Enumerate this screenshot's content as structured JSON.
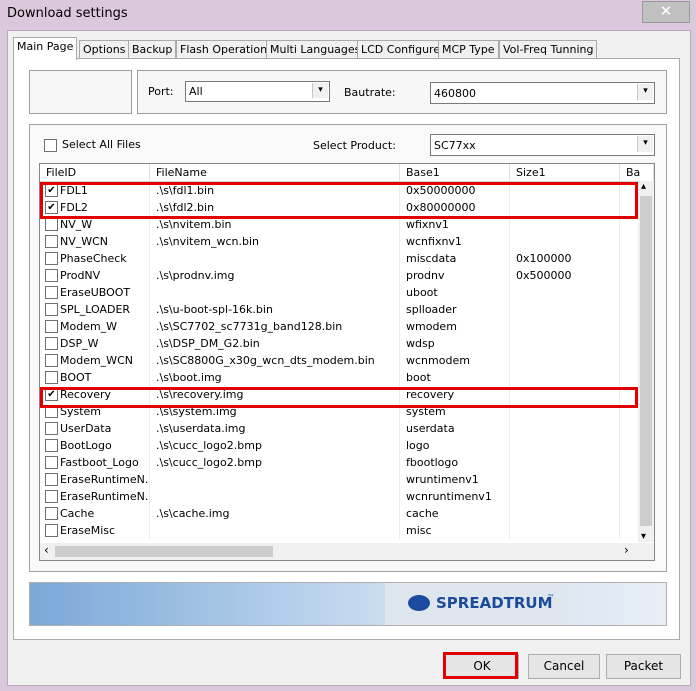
{
  "window": {
    "title": "Download settings",
    "close_glyph": "✕"
  },
  "tabs": [
    "Main Page",
    "Options",
    "Backup",
    "Flash Operations",
    "Multi Languages",
    "LCD Configure",
    "MCP Type",
    "Vol-Freq Tunning"
  ],
  "port": {
    "label": "Port:",
    "value": "All"
  },
  "baudrate": {
    "label": "Bautrate:",
    "value": "460800"
  },
  "select_all": {
    "label": "Select All Files",
    "checked": false
  },
  "product": {
    "label": "Select Product:",
    "value": "SC77xx"
  },
  "columns": [
    "FileID",
    "FileName",
    "Base1",
    "Size1",
    "Ba"
  ],
  "rows": [
    {
      "id": "FDL1",
      "file": ".\\s\\fdl1.bin",
      "base": "0x50000000",
      "size": "",
      "checked": true
    },
    {
      "id": "FDL2",
      "file": ".\\s\\fdl2.bin",
      "base": "0x80000000",
      "size": "",
      "checked": true
    },
    {
      "id": "NV_W",
      "file": ".\\s\\nvitem.bin",
      "base": "wfixnv1",
      "size": "",
      "checked": false
    },
    {
      "id": "NV_WCN",
      "file": ".\\s\\nvitem_wcn.bin",
      "base": "wcnfixnv1",
      "size": "",
      "checked": false
    },
    {
      "id": "PhaseCheck",
      "file": "",
      "base": "miscdata",
      "size": "0x100000",
      "checked": false
    },
    {
      "id": "ProdNV",
      "file": ".\\s\\prodnv.img",
      "base": "prodnv",
      "size": "0x500000",
      "checked": false
    },
    {
      "id": "EraseUBOOT",
      "file": "",
      "base": "uboot",
      "size": "",
      "checked": false
    },
    {
      "id": "SPL_LOADER",
      "file": ".\\s\\u-boot-spl-16k.bin",
      "base": "splloader",
      "size": "",
      "checked": false
    },
    {
      "id": "Modem_W",
      "file": ".\\s\\SC7702_sc7731g_band128.bin",
      "base": "wmodem",
      "size": "",
      "checked": false
    },
    {
      "id": "DSP_W",
      "file": ".\\s\\DSP_DM_G2.bin",
      "base": "wdsp",
      "size": "",
      "checked": false
    },
    {
      "id": "Modem_WCN",
      "file": ".\\s\\SC8800G_x30g_wcn_dts_modem.bin",
      "base": "wcnmodem",
      "size": "",
      "checked": false
    },
    {
      "id": "BOOT",
      "file": ".\\s\\boot.img",
      "base": "boot",
      "size": "",
      "checked": false
    },
    {
      "id": "Recovery",
      "file": ".\\s\\recovery.img",
      "base": "recovery",
      "size": "",
      "checked": true
    },
    {
      "id": "System",
      "file": ".\\s\\system.img",
      "base": "system",
      "size": "",
      "checked": false
    },
    {
      "id": "UserData",
      "file": ".\\s\\userdata.img",
      "base": "userdata",
      "size": "",
      "checked": false
    },
    {
      "id": "BootLogo",
      "file": ".\\s\\cucc_logo2.bmp",
      "base": "logo",
      "size": "",
      "checked": false
    },
    {
      "id": "Fastboot_Logo",
      "file": ".\\s\\cucc_logo2.bmp",
      "base": "fbootlogo",
      "size": "",
      "checked": false
    },
    {
      "id": "EraseRuntimeN...",
      "file": "",
      "base": "wruntimenv1",
      "size": "",
      "checked": false
    },
    {
      "id": "EraseRuntimeN...",
      "file": "",
      "base": "wcnruntimenv1",
      "size": "",
      "checked": false
    },
    {
      "id": "Cache",
      "file": ".\\s\\cache.img",
      "base": "cache",
      "size": "",
      "checked": false
    },
    {
      "id": "EraseMisc",
      "file": "",
      "base": "misc",
      "size": "",
      "checked": false
    }
  ],
  "banner": {
    "logo_text": "SPREADTRUM",
    "trademark": "™"
  },
  "buttons": {
    "ok": "OK",
    "cancel": "Cancel",
    "packet": "Packet"
  },
  "scroll_glyphs": {
    "up": "▴",
    "down": "▾",
    "left": "‹",
    "right": "›"
  },
  "check_glyph": "✔",
  "accent": {
    "highlight": "#e00000",
    "banner_blue": "#1c4a9c"
  }
}
